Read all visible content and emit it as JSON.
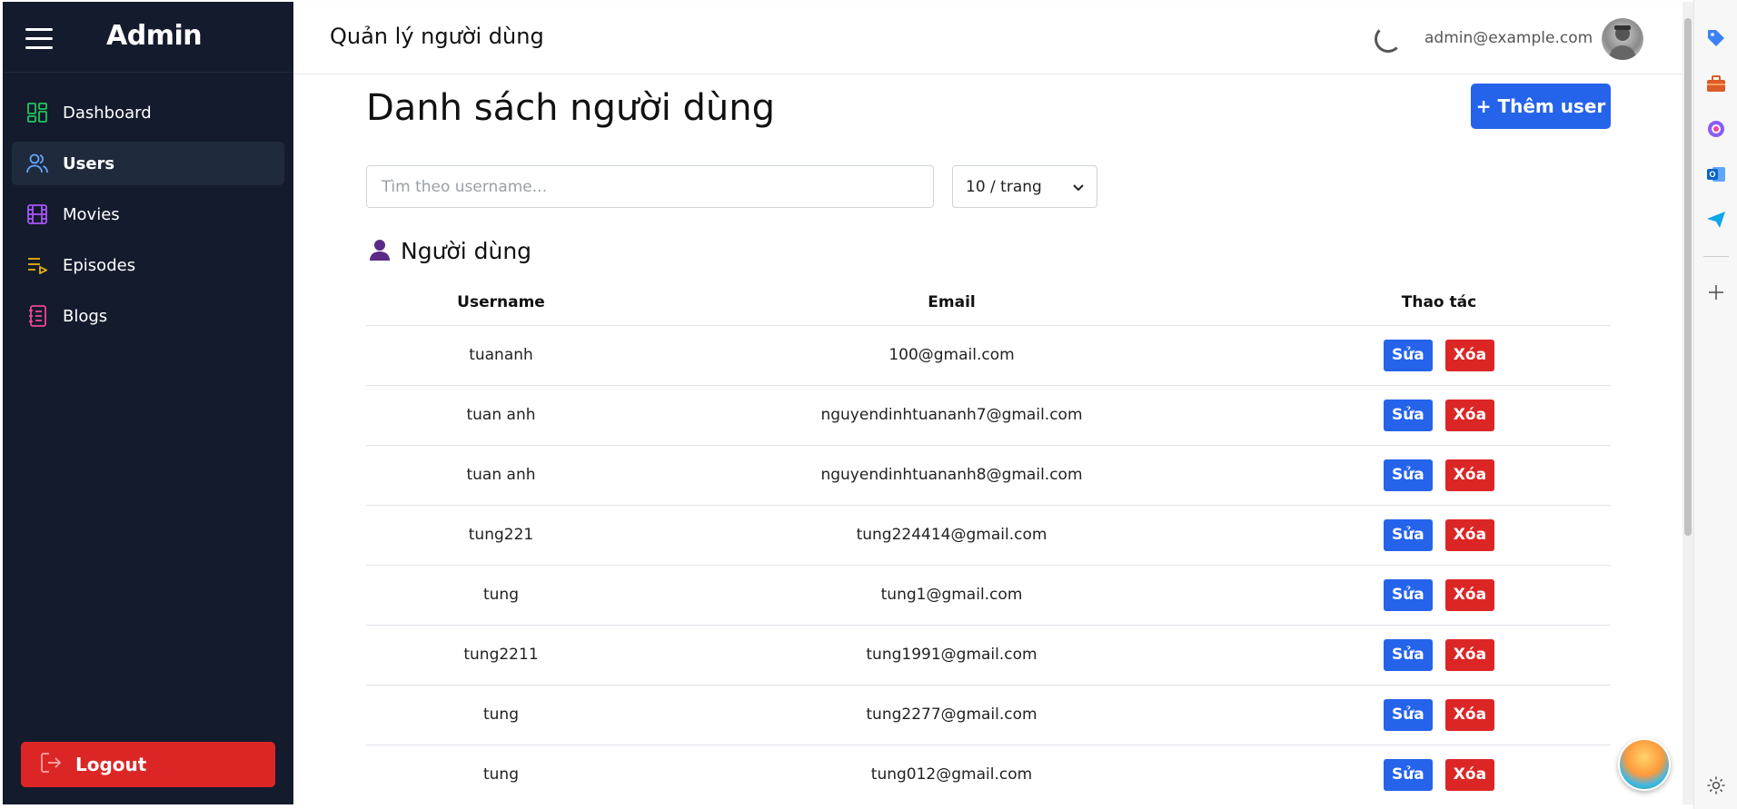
{
  "sidebar": {
    "title": "Admin",
    "items": [
      {
        "label": "Dashboard",
        "icon": "dashboard-icon",
        "color": "#22c55e"
      },
      {
        "label": "Users",
        "icon": "users-icon",
        "color": "#60a5fa",
        "active": true
      },
      {
        "label": "Movies",
        "icon": "film-icon",
        "color": "#a855f7"
      },
      {
        "label": "Episodes",
        "icon": "playlist-icon",
        "color": "#eab308"
      },
      {
        "label": "Blogs",
        "icon": "notebook-icon",
        "color": "#ec4899"
      }
    ],
    "logout_label": "Logout"
  },
  "header": {
    "title": "Quản lý người dùng",
    "email": "admin@example.com"
  },
  "main": {
    "title": "Danh sách người dùng",
    "add_button": "+ Thêm user",
    "search_placeholder": "Tìm theo username...",
    "per_page": "10 / trang",
    "section_title": "Người dùng",
    "columns": [
      "Username",
      "Email",
      "Thao tác"
    ],
    "edit_label": "Sửa",
    "delete_label": "Xóa",
    "rows": [
      {
        "username": "tuananh",
        "email": "100@gmail.com"
      },
      {
        "username": "tuan anh",
        "email": "nguyendinhtuananh7@gmail.com"
      },
      {
        "username": "tuan anh",
        "email": "nguyendinhtuananh8@gmail.com"
      },
      {
        "username": "tung221",
        "email": "tung224414@gmail.com"
      },
      {
        "username": "tung",
        "email": "tung1@gmail.com"
      },
      {
        "username": "tung2211",
        "email": "tung1991@gmail.com"
      },
      {
        "username": "tung",
        "email": "tung2277@gmail.com"
      },
      {
        "username": "tung",
        "email": "tung012@gmail.com"
      }
    ]
  },
  "colors": {
    "sidebar_bg": "#141b2d",
    "primary": "#2563eb",
    "danger": "#dc2626"
  }
}
